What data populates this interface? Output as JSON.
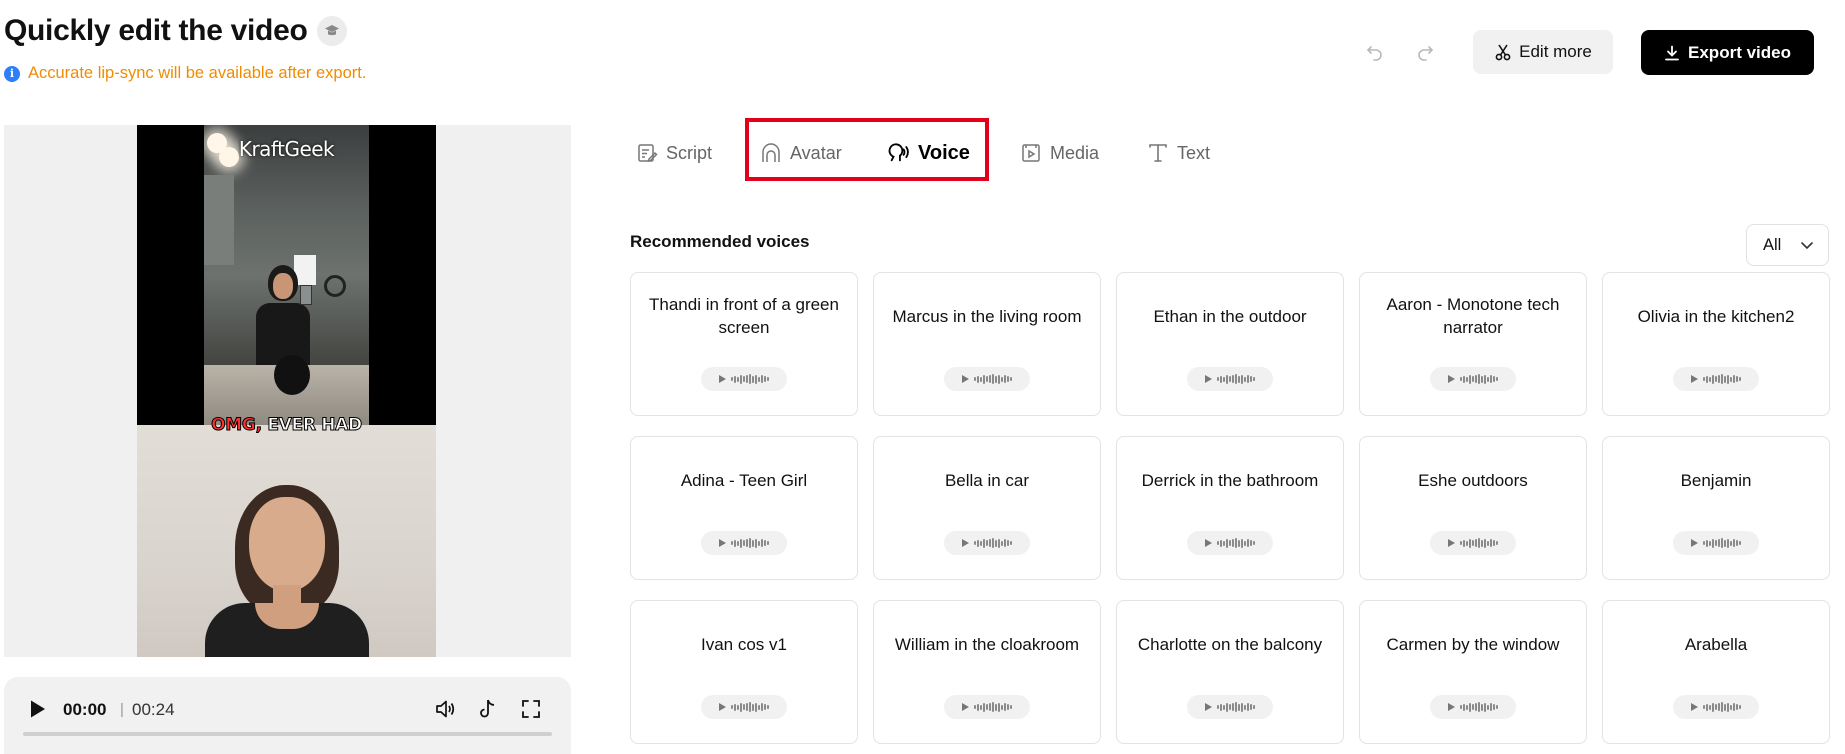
{
  "header": {
    "title": "Quickly edit the video",
    "notice": "Accurate lip-sync will be available after export.",
    "edit_more_label": "Edit more",
    "export_label": "Export video"
  },
  "preview": {
    "brand_text": "KraftGeek",
    "caption_red": "OMG,",
    "caption_white": "EVER HAD"
  },
  "player": {
    "current_time": "00:00",
    "separator": "|",
    "total_time": "00:24",
    "progress_fraction": 0
  },
  "tabs": [
    {
      "label": "Script",
      "icon": "script-icon",
      "active": false
    },
    {
      "label": "Avatar",
      "icon": "avatar-icon",
      "active": false
    },
    {
      "label": "Voice",
      "icon": "voice-icon",
      "active": true
    },
    {
      "label": "Media",
      "icon": "media-icon",
      "active": false
    },
    {
      "label": "Text",
      "icon": "text-icon",
      "active": false
    }
  ],
  "voices": {
    "section_title": "Recommended voices",
    "filter_value": "All",
    "items": [
      "Thandi in front of a green screen",
      "Marcus in the living room",
      "Ethan in the outdoor",
      "Aaron - Monotone tech narrator",
      "Olivia in the kitchen2",
      "Adina - Teen Girl",
      "Bella in car",
      "Derrick in the bathroom",
      "Eshe outdoors",
      "Benjamin",
      "Ivan cos v1",
      "William in the cloakroom",
      "Charlotte on the balcony",
      "Carmen by the window",
      "Arabella"
    ]
  },
  "colors": {
    "accent_notice": "#f08c00",
    "info_icon": "#2d7ff9",
    "highlight_box": "#e3001b",
    "export_bg": "#000000"
  }
}
